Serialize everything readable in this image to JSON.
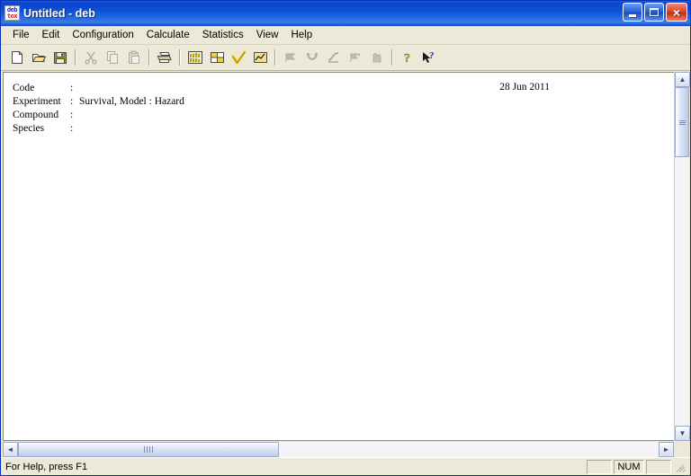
{
  "window": {
    "title": "Untitled - deb",
    "icon_name": "debtox-app-icon",
    "icon_line1": "deb",
    "icon_line2": "tox",
    "caption": {
      "minimize_label": "_",
      "maximize_label": "□",
      "close_label": "×"
    }
  },
  "menubar": {
    "items": [
      {
        "label": "File"
      },
      {
        "label": "Edit"
      },
      {
        "label": "Configuration"
      },
      {
        "label": "Calculate"
      },
      {
        "label": "Statistics"
      },
      {
        "label": "View"
      },
      {
        "label": "Help"
      }
    ]
  },
  "toolbar": {
    "buttons": [
      {
        "name": "new-document",
        "tip": "New",
        "enabled": true
      },
      {
        "name": "open-document",
        "tip": "Open",
        "enabled": true
      },
      {
        "name": "save-document",
        "tip": "Save",
        "enabled": true
      },
      {
        "name": "cut",
        "tip": "Cut",
        "enabled": false
      },
      {
        "name": "copy",
        "tip": "Copy",
        "enabled": false
      },
      {
        "name": "paste",
        "tip": "Paste",
        "enabled": false
      },
      {
        "name": "print",
        "tip": "Print",
        "enabled": true
      },
      {
        "name": "data-text",
        "tip": "Data",
        "enabled": true
      },
      {
        "name": "table-grid",
        "tip": "Table",
        "enabled": true
      },
      {
        "name": "check-model",
        "tip": "Check",
        "enabled": true
      },
      {
        "name": "plot-chart",
        "tip": "Plot",
        "enabled": true
      },
      {
        "name": "curve-1",
        "tip": "Curve",
        "enabled": false
      },
      {
        "name": "curve-2",
        "tip": "Curve",
        "enabled": false
      },
      {
        "name": "curve-3",
        "tip": "Curve",
        "enabled": false
      },
      {
        "name": "curve-4",
        "tip": "Curve",
        "enabled": false
      },
      {
        "name": "curve-5",
        "tip": "Curve",
        "enabled": false
      },
      {
        "name": "help-about",
        "tip": "Help",
        "enabled": true
      },
      {
        "name": "context-help",
        "tip": "Context Help",
        "enabled": true
      }
    ]
  },
  "document": {
    "date": "28 Jun 2011",
    "rows": [
      {
        "label": "Code",
        "separator": ":",
        "value": ""
      },
      {
        "label": "Experiment",
        "separator": ":",
        "value": "Survival, Model : Hazard"
      },
      {
        "label": "Compound",
        "separator": ":",
        "value": ""
      },
      {
        "label": "Species",
        "separator": ":",
        "value": ""
      }
    ]
  },
  "scrollbars": {
    "vertical": {
      "up_arrow": "▲",
      "down_arrow": "▼"
    },
    "horizontal": {
      "left_arrow": "◄",
      "right_arrow": "►"
    }
  },
  "statusbar": {
    "message": "For Help, press F1",
    "panes": [
      "",
      "NUM",
      ""
    ]
  },
  "colors": {
    "title_blue": "#0a45d0",
    "chrome": "#ece9d8",
    "close_red": "#e0452a",
    "accent_yellow": "#f2d12a"
  }
}
